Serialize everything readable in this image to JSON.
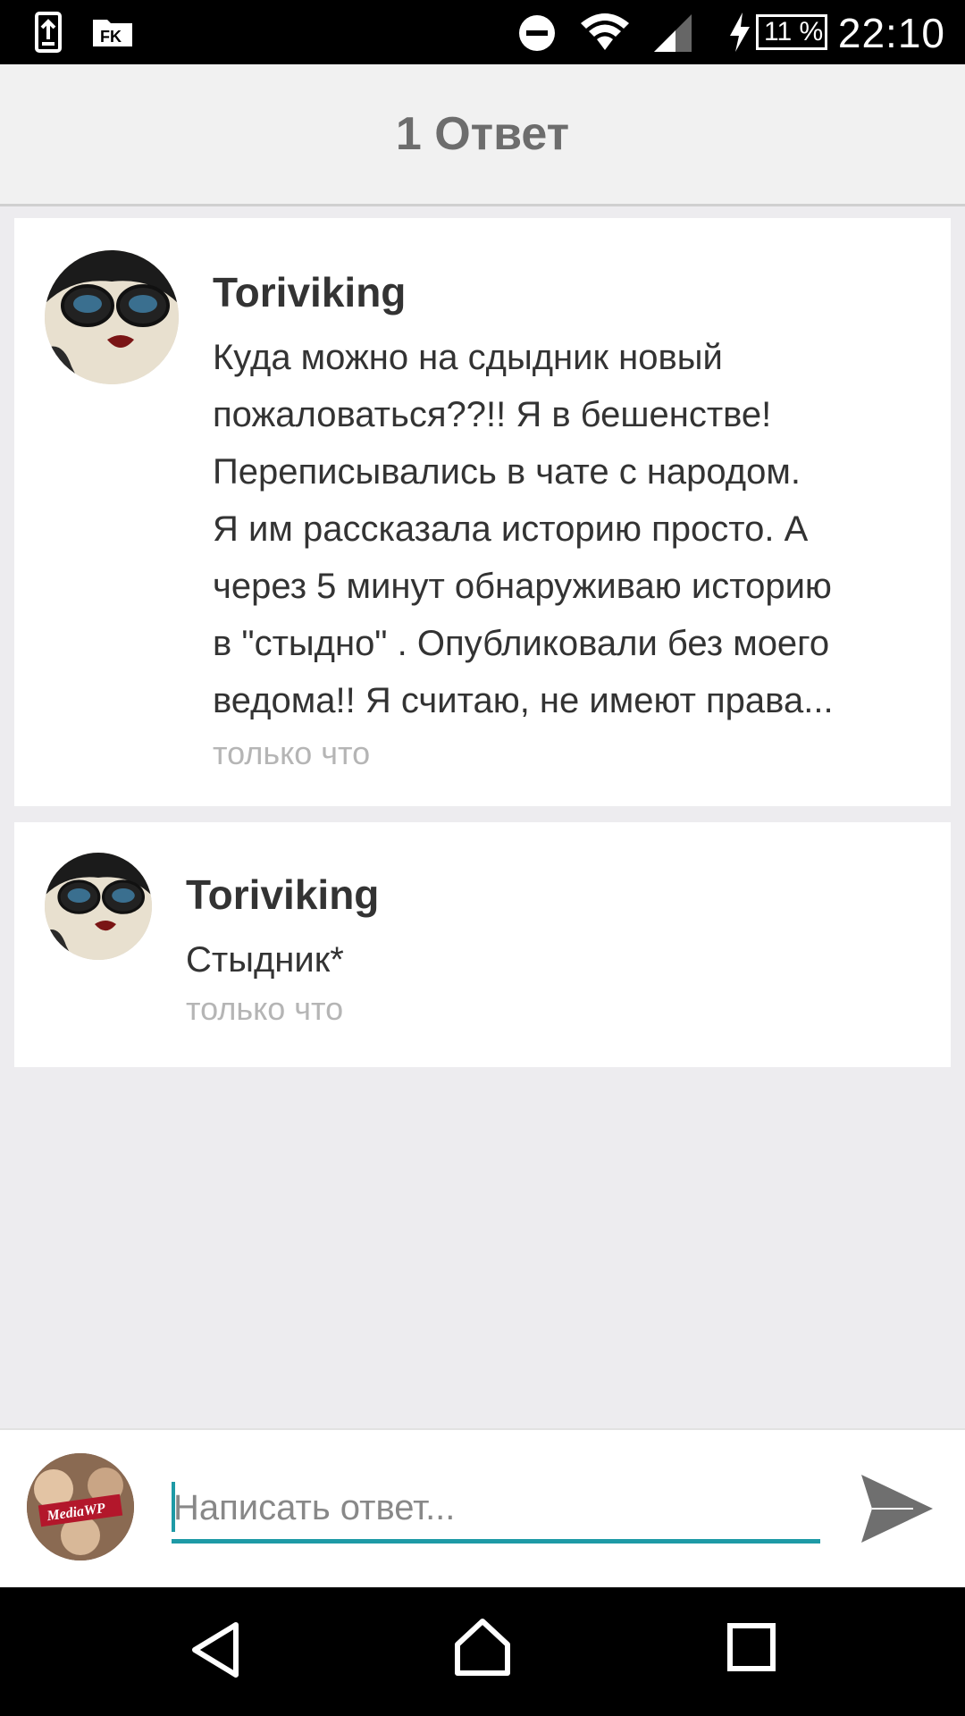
{
  "status_bar": {
    "time": "22:10",
    "battery": "11 %",
    "icons": [
      "upload-icon",
      "app-icon",
      "do-not-disturb-icon",
      "wifi-icon",
      "signal-icon",
      "charging-icon",
      "battery-icon"
    ]
  },
  "header": {
    "title": "1 Ответ"
  },
  "comments": [
    {
      "author": "Toriviking",
      "text": "Куда можно на сдыдник новый\nпожаловаться??!! Я в бешенстве!\nПереписывались в чате с народом.\nЯ им рассказала историю просто. А\nчерез 5 минут обнаруживаю историю\nв \"стыдно\" . Опубликовали без моего\nведома!! Я считаю, не имеют права...",
      "time": "только что"
    },
    {
      "author": "Toriviking",
      "text": "Стыдник*",
      "time": "только что"
    }
  ],
  "reply": {
    "placeholder": "Написать ответ...",
    "avatar_label": "MediaWP",
    "send_icon": "send-icon"
  },
  "nav": {
    "icons": [
      "back-icon",
      "home-icon",
      "recents-icon"
    ]
  },
  "colors": {
    "accent": "#1e9aa6",
    "header_bg": "#f1f1f1",
    "page_bg": "#edecef"
  }
}
